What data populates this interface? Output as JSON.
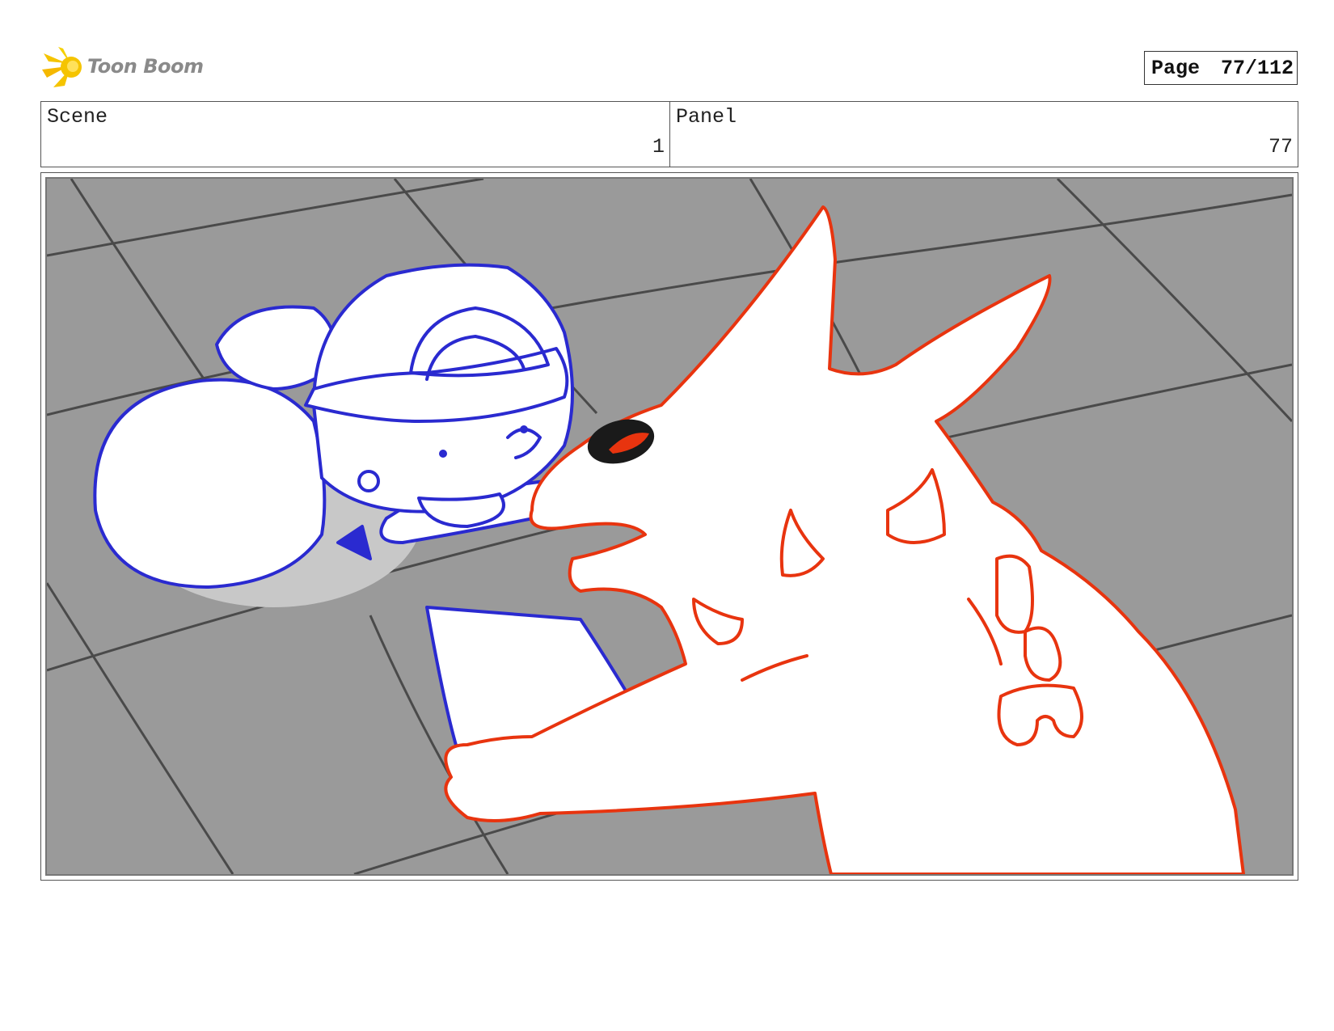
{
  "header": {
    "logo_text": "Toon Boom",
    "page_label": "Page",
    "page_number": "77/112"
  },
  "info": {
    "scene_label": "Scene",
    "scene_value": "1",
    "panel_label": "Panel",
    "panel_value": "77"
  },
  "artwork": {
    "icon": "storyboard-sketch",
    "colors": {
      "floor": "#9a9a9a",
      "grid_lines": "#4a4a4a",
      "girl_outline": "#2a2ad0",
      "creature_outline": "#e8340f",
      "shadow": "#c8c8c8"
    }
  }
}
